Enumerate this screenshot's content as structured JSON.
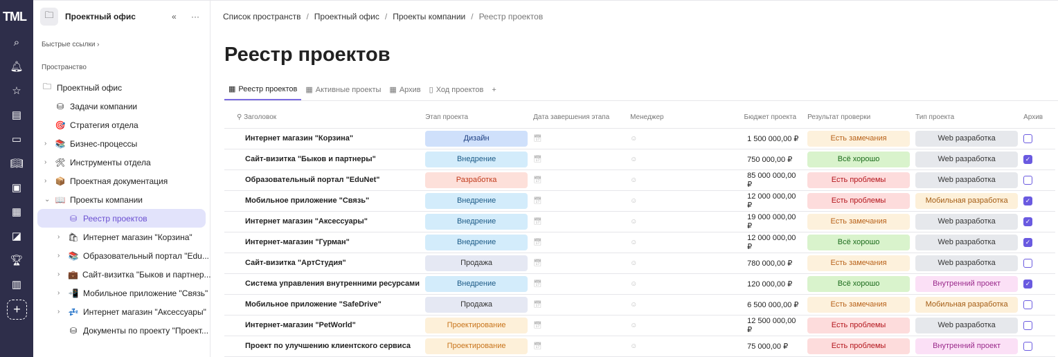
{
  "logo": "TML",
  "rail_icons": [
    "search-icon",
    "bell-icon",
    "star-icon",
    "inbox-icon",
    "folder-icon",
    "book-icon",
    "form-icon",
    "calculator-icon",
    "chart-icon",
    "trophy-icon",
    "clipboard-icon"
  ],
  "sidebar": {
    "space_title": "Проектный офис",
    "quick_links": "Быстрые ссылки",
    "section": "Пространство",
    "items": [
      {
        "label": "Проектный офис",
        "icon": "🗀",
        "level": 0
      },
      {
        "label": "Задачи компании",
        "icon": "⛁",
        "level": 1
      },
      {
        "label": "Стратегия отдела",
        "icon": "🎯",
        "level": 1
      },
      {
        "label": "Бизнес-процессы",
        "icon": "📚",
        "level": 1,
        "chev": "›"
      },
      {
        "label": "Инструменты отдела",
        "icon": "🛠",
        "level": 1,
        "chev": "›"
      },
      {
        "label": "Проектная документация",
        "icon": "📦",
        "level": 1,
        "chev": "›"
      },
      {
        "label": "Проекты компании",
        "icon": "📖",
        "level": 1,
        "chev": "⌄"
      },
      {
        "label": "Реестр проектов",
        "icon": "⛁",
        "level": 2,
        "active": true
      },
      {
        "label": "Интернет магазин \"Корзина\"",
        "icon": "🛍",
        "level": 2,
        "chev": "›"
      },
      {
        "label": "Образовательный портал \"Edu...",
        "icon": "📚",
        "level": 2,
        "chev": "›"
      },
      {
        "label": "Сайт-визитка \"Быков и партнер...",
        "icon": "💼",
        "level": 2,
        "chev": "›"
      },
      {
        "label": "Мобильное приложение \"Связь\"",
        "icon": "📲",
        "level": 2,
        "chev": "›"
      },
      {
        "label": "Интернет магазин \"Аксессуары\"",
        "icon": "💤",
        "level": 2,
        "chev": "›"
      },
      {
        "label": "Документы по проекту \"Проект...",
        "icon": "⛁",
        "level": 2
      }
    ]
  },
  "breadcrumbs": [
    "Список пространств",
    "Проектный офис",
    "Проекты компании",
    "Реестр проектов"
  ],
  "page_title": "Реестр проектов",
  "tabs": [
    {
      "label": "Реестр проектов",
      "icon": "▦"
    },
    {
      "label": "Активные проекты",
      "icon": "▦"
    },
    {
      "label": "Архив",
      "icon": "▦"
    },
    {
      "label": "Ход проектов",
      "icon": "▯"
    }
  ],
  "columns": [
    "Заголовок",
    "Этап проекта",
    "Дата завершения этапа",
    "Менеджер",
    "Бюджет проекта",
    "Результат проверки",
    "Тип проекта",
    "Архив"
  ],
  "colors": {
    "Дизайн": [
      "#cfe0fb",
      "#1b3d80"
    ],
    "Внедрение": [
      "#d3ecfb",
      "#1c5a86"
    ],
    "Разработка": [
      "#fde0da",
      "#c0391b"
    ],
    "Продажа": [
      "#e5e8f3",
      "#333333"
    ],
    "Проектирование": [
      "#fdf0d9",
      "#c8741b"
    ],
    "Есть замечания": [
      "#fdf1dc",
      "#b8621a"
    ],
    "Всё хорошо": [
      "#d9f3cc",
      "#1c6b1c"
    ],
    "Есть проблемы": [
      "#fddcdc",
      "#b3141b"
    ],
    "Web разработка": [
      "#e6e8ec",
      "#333333"
    ],
    "Мобильная разработка": [
      "#fdf0d9",
      "#a35b12"
    ],
    "Внутренний проект": [
      "#fbe0f6",
      "#9a2a8b"
    ]
  },
  "rows": [
    {
      "title": "Интернет магазин \"Корзина\"",
      "stage": "Дизайн",
      "budget": "1 500 000,00 ₽",
      "result": "Есть замечания",
      "type": "Web разработка",
      "archive": false
    },
    {
      "title": "Сайт-визитка \"Быков и партнеры\"",
      "stage": "Внедрение",
      "budget": "750 000,00 ₽",
      "result": "Всё хорошо",
      "type": "Web разработка",
      "archive": true
    },
    {
      "title": "Образовательный портал \"EduNet\"",
      "stage": "Разработка",
      "budget": "85 000 000,00 ₽",
      "result": "Есть проблемы",
      "type": "Web разработка",
      "archive": false
    },
    {
      "title": "Мобильное приложение \"Связь\"",
      "stage": "Внедрение",
      "budget": "12 000 000,00 ₽",
      "result": "Есть проблемы",
      "type": "Мобильная разработка",
      "archive": true
    },
    {
      "title": "Интернет магазин \"Аксессуары\"",
      "stage": "Внедрение",
      "budget": "19 000 000,00 ₽",
      "result": "Есть замечания",
      "type": "Web разработка",
      "archive": true
    },
    {
      "title": "Интернет-магазин \"Гурман\"",
      "stage": "Внедрение",
      "budget": "12 000 000,00 ₽",
      "result": "Всё хорошо",
      "type": "Web разработка",
      "archive": true
    },
    {
      "title": "Сайт-визитка \"АртСтудия\"",
      "stage": "Продажа",
      "budget": "780 000,00 ₽",
      "result": "Есть замечания",
      "type": "Web разработка",
      "archive": false
    },
    {
      "title": "Система управления внутренними ресурсами",
      "stage": "Внедрение",
      "budget": "120 000,00 ₽",
      "result": "Всё хорошо",
      "type": "Внутренний проект",
      "archive": true
    },
    {
      "title": "Мобильное приложение \"SafeDrive\"",
      "stage": "Продажа",
      "budget": "6 500 000,00 ₽",
      "result": "Есть замечания",
      "type": "Мобильная разработка",
      "archive": false
    },
    {
      "title": "Интернет-магазин \"PetWorld\"",
      "stage": "Проектирование",
      "budget": "12 500 000,00 ₽",
      "result": "Есть проблемы",
      "type": "Web разработка",
      "archive": false
    },
    {
      "title": "Проект по улучшению клиентского сервиса",
      "stage": "Проектирование",
      "budget": "75 000,00 ₽",
      "result": "Есть проблемы",
      "type": "Внутренний проект",
      "archive": false
    }
  ]
}
